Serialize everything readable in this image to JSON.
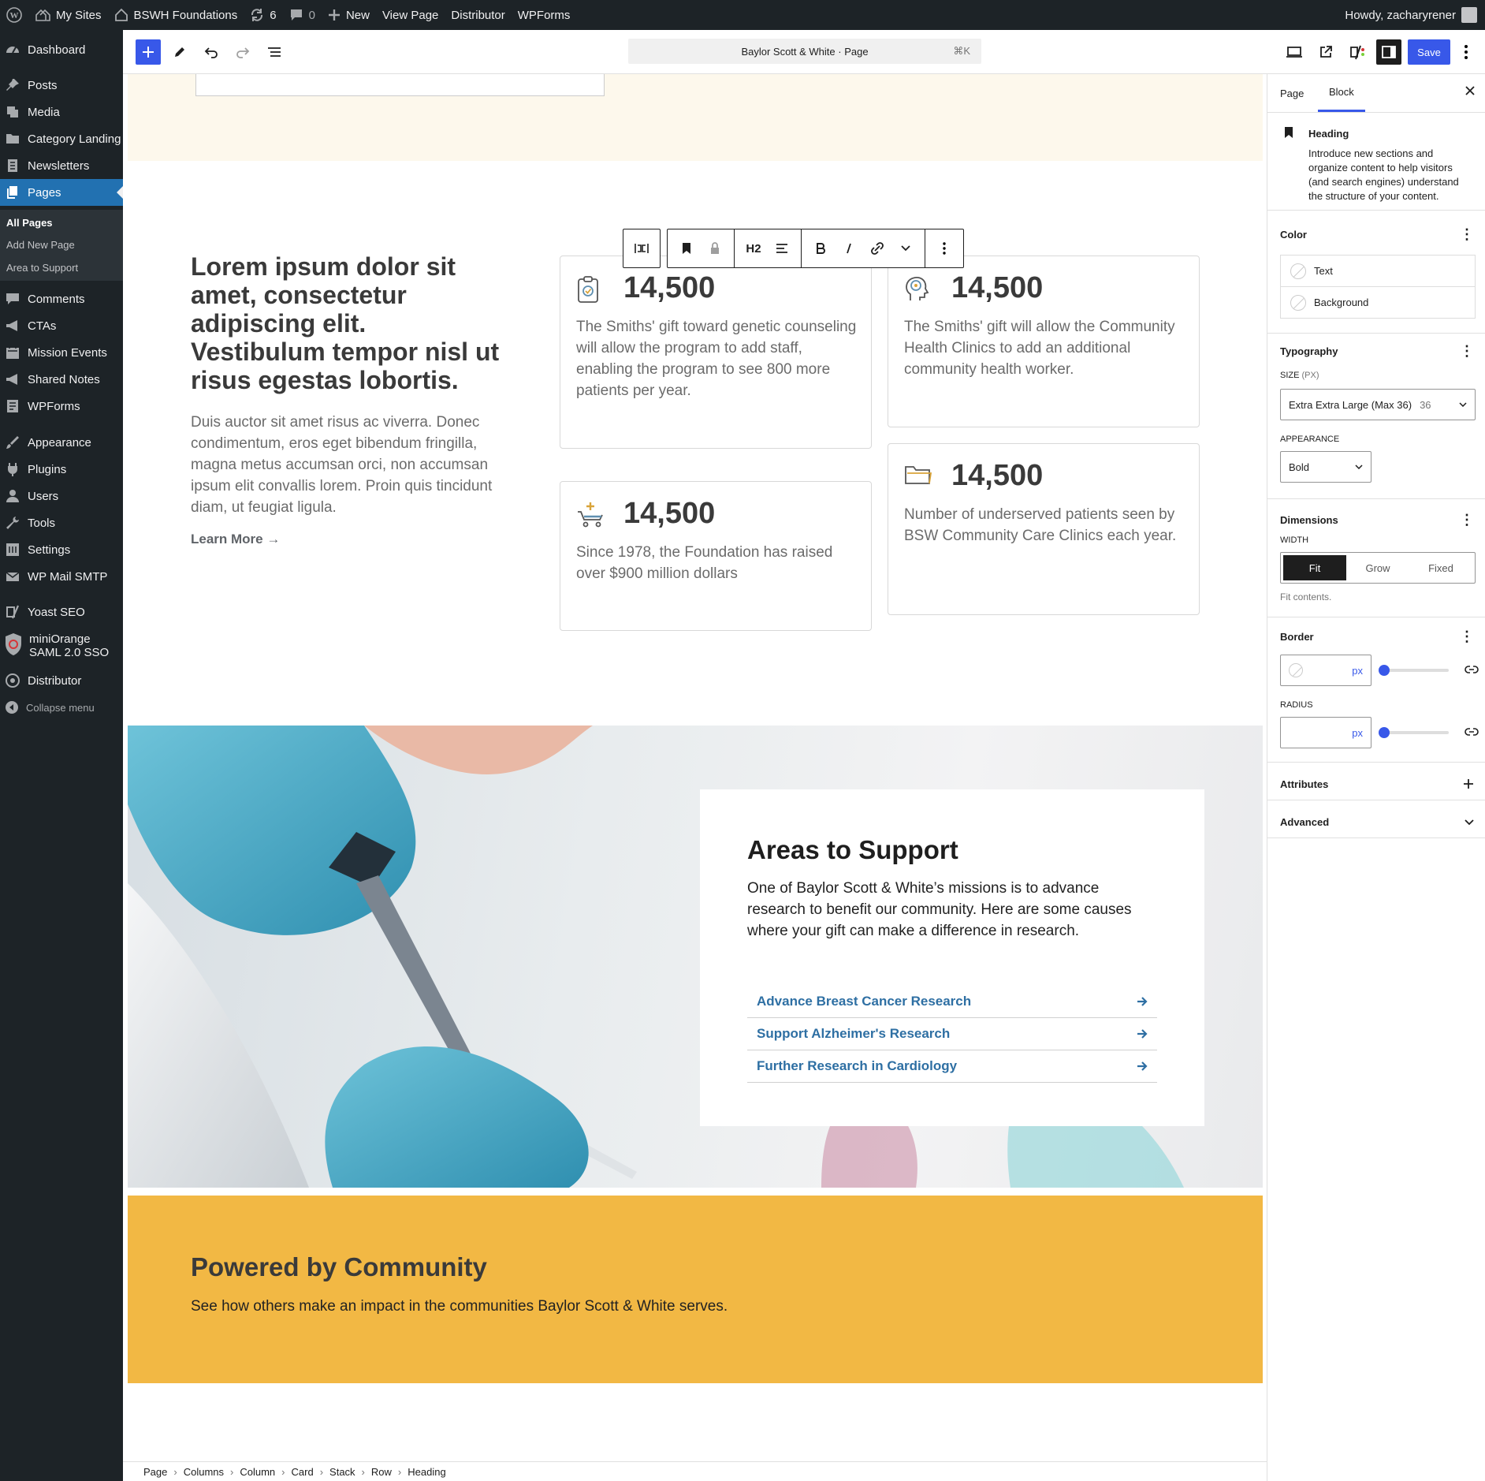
{
  "admin_bar": {
    "my_sites": "My Sites",
    "site_name": "BSWH Foundations",
    "updates_count": "6",
    "comments_count": "0",
    "new_label": "New",
    "view_page": "View Page",
    "distributor": "Distributor",
    "wpforms": "WPForms",
    "greeting": "Howdy, zacharyrener"
  },
  "admin_menu": {
    "items": [
      {
        "label": "Dashboard",
        "icon": "dashboard-icon"
      },
      {
        "label": "Posts",
        "icon": "pin-icon"
      },
      {
        "label": "Media",
        "icon": "media-icon"
      },
      {
        "label": "Category Landing",
        "icon": "folder-icon"
      },
      {
        "label": "Newsletters",
        "icon": "document-icon"
      },
      {
        "label": "Pages",
        "icon": "pages-icon",
        "current": true
      },
      {
        "label": "Comments",
        "icon": "comment-icon"
      },
      {
        "label": "CTAs",
        "icon": "megaphone-icon"
      },
      {
        "label": "Mission Events",
        "icon": "calendar-icon"
      },
      {
        "label": "Shared Notes",
        "icon": "megaphone-icon"
      },
      {
        "label": "WPForms",
        "icon": "form-icon"
      },
      {
        "label": "Appearance",
        "icon": "brush-icon"
      },
      {
        "label": "Plugins",
        "icon": "plugin-icon"
      },
      {
        "label": "Users",
        "icon": "user-icon"
      },
      {
        "label": "Tools",
        "icon": "wrench-icon"
      },
      {
        "label": "Settings",
        "icon": "settings-icon"
      },
      {
        "label": "WP Mail SMTP",
        "icon": "mail-icon"
      },
      {
        "label": "Yoast SEO",
        "icon": "yoast-icon"
      },
      {
        "label": "miniOrange SAML 2.0 SSO",
        "icon": "shield-icon"
      },
      {
        "label": "Distributor",
        "icon": "distributor-icon"
      }
    ],
    "submenu": [
      "All Pages",
      "Add New Page",
      "Area to Support"
    ],
    "collapse": "Collapse menu"
  },
  "editor_header": {
    "document_title": "Baylor Scott & White · Page",
    "shortcut": "⌘K",
    "save": "Save"
  },
  "block_toolbar": {
    "heading_level": "H2"
  },
  "content": {
    "intro_heading": "Lorem ipsum dolor sit amet, consectetur adipiscing elit. Vestibulum tempor nisl ut risus egestas lobortis.",
    "intro_text": "Duis auctor sit amet risus ac viverra. Donec condimentum, eros eget bibendum fringilla, magna metus accumsan orci, non accumsan ipsum elit convallis lorem. Proin quis tincidunt diam, ut feugiat ligula.",
    "learn_more": "Learn More →",
    "stat_cards": [
      {
        "value": "14,500",
        "text": "The Smiths' gift toward genetic counseling will allow the program to add staff, enabling the program to see 800 more patients per year.",
        "icon": "clipboard-icon"
      },
      {
        "value": "14,500",
        "text": "The Smiths' gift will allow the Community Health Clinics to add an additional community health worker.",
        "icon": "brain-icon"
      },
      {
        "value": "14,500",
        "text": "Since 1978, the Foundation has raised over $900 million dollars",
        "icon": "hospital-bed-icon"
      },
      {
        "value": "14,500",
        "text": "Number of underserved patients seen by BSW Community Care Clinics each year.",
        "icon": "folder-icon"
      }
    ],
    "support": {
      "heading": "Areas to Support",
      "text": "One of Baylor Scott & White’s missions is to advance research to benefit our community. Here are some causes where your gift can make a difference in research.",
      "links": [
        "Advance Breast Cancer Research",
        "Support Alzheimer's Research",
        "Further Research in Cardiology"
      ]
    },
    "community": {
      "heading": "Powered by Community",
      "text": "See how others make an impact in the communities Baylor Scott & White serves."
    }
  },
  "breadcrumbs": [
    "Page",
    "Columns",
    "Column",
    "Card",
    "Stack",
    "Row",
    "Heading"
  ],
  "inspector": {
    "tabs": [
      "Page",
      "Block"
    ],
    "block_name": "Heading",
    "block_description": "Introduce new sections and organize content to help visitors (and search engines) understand the structure of your content.",
    "color_title": "Color",
    "color_text": "Text",
    "color_background": "Background",
    "typography_title": "Typography",
    "size_label": "SIZE",
    "size_unit": "(PX)",
    "size_value": "Extra Extra Large (Max 36)",
    "size_number": "36",
    "appearance_label": "APPEARANCE",
    "appearance_value": "Bold",
    "dimensions_title": "Dimensions",
    "width_label": "WIDTH",
    "width_options": [
      "Fit",
      "Grow",
      "Fixed"
    ],
    "width_help": "Fit contents.",
    "border_title": "Border",
    "unit_px": "px",
    "radius_label": "RADIUS",
    "attributes_title": "Attributes",
    "advanced_title": "Advanced"
  },
  "colors": {
    "accent": "#3858e9",
    "admin_bg": "#1d2327",
    "menu_current": "#2271b1",
    "community_bg": "#f2b844",
    "cream_bg": "#fdf8ec",
    "link": "#2e6fa3"
  }
}
